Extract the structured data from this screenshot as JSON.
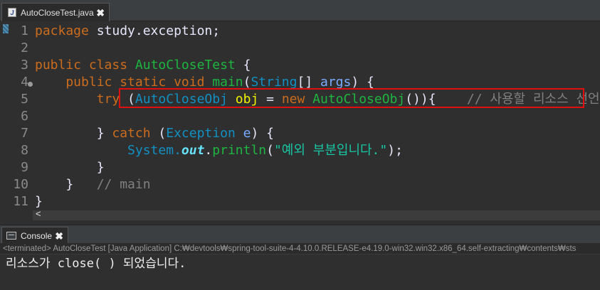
{
  "editor": {
    "tab_label": "AutoCloseTest.java",
    "tab_icon": "java-file-icon",
    "close_glyph": "✖",
    "line_numbers": [
      "1",
      "2",
      "3",
      "4",
      "5",
      "6",
      "7",
      "8",
      "9",
      "10",
      "11"
    ],
    "lines": [
      {
        "segs": [
          {
            "t": "package ",
            "c": "kw"
          },
          {
            "t": "study.exception;",
            "c": "pl"
          }
        ]
      },
      {
        "segs": []
      },
      {
        "segs": [
          {
            "t": "public class ",
            "c": "kw"
          },
          {
            "t": "AutoCloseTest",
            "c": "cls-main"
          },
          {
            "t": " {",
            "c": "pl"
          }
        ]
      },
      {
        "segs": [
          {
            "t": "    public static void ",
            "c": "kw"
          },
          {
            "t": "main",
            "c": "fn"
          },
          {
            "t": "(",
            "c": "pl"
          },
          {
            "t": "String",
            "c": "cls"
          },
          {
            "t": "[] ",
            "c": "pl"
          },
          {
            "t": "args",
            "c": "param"
          },
          {
            "t": ") {",
            "c": "pl"
          }
        ]
      },
      {
        "segs": [
          {
            "t": "        try ",
            "c": "kw"
          },
          {
            "t": "(",
            "c": "pl"
          },
          {
            "t": "AutoCloseObj ",
            "c": "cls"
          },
          {
            "t": "obj",
            "c": "var"
          },
          {
            "t": " = ",
            "c": "pl"
          },
          {
            "t": "new ",
            "c": "kw"
          },
          {
            "t": "AutoCloseObj",
            "c": "fn"
          },
          {
            "t": "()){",
            "c": "pl"
          },
          {
            "t": "    // 사용할 리소스 선언",
            "c": "cmt"
          }
        ]
      },
      {
        "segs": []
      },
      {
        "segs": [
          {
            "t": "        } ",
            "c": "pl"
          },
          {
            "t": "catch ",
            "c": "kw"
          },
          {
            "t": "(",
            "c": "pl"
          },
          {
            "t": "Exception ",
            "c": "cls"
          },
          {
            "t": "e",
            "c": "param"
          },
          {
            "t": ") {",
            "c": "pl"
          }
        ]
      },
      {
        "segs": [
          {
            "t": "            System.",
            "c": "cls"
          },
          {
            "t": "out",
            "c": "fld"
          },
          {
            "t": ".",
            "c": "pl"
          },
          {
            "t": "println",
            "c": "fn"
          },
          {
            "t": "(",
            "c": "pl"
          },
          {
            "t": "\"예외 부분입니다.\"",
            "c": "str"
          },
          {
            "t": ");",
            "c": "pl"
          }
        ]
      },
      {
        "segs": [
          {
            "t": "        }",
            "c": "pl"
          }
        ]
      },
      {
        "segs": [
          {
            "t": "    }   ",
            "c": "pl"
          },
          {
            "t": "// main",
            "c": "cmt"
          }
        ]
      },
      {
        "segs": [
          {
            "t": "}",
            "c": "pl"
          }
        ]
      }
    ],
    "scroll_left_glyph": "<"
  },
  "console": {
    "tab_label": "Console",
    "tab_icon": "console-icon",
    "close_glyph": "✖",
    "status": "<terminated> AutoCloseTest [Java Application] C:₩devtools₩spring-tool-suite-4-4.10.0.RELEASE-e4.19.0-win32.win32.x86_64.self-extracting₩contents₩sts",
    "output": "리소스가 close( ) 되었습니다."
  },
  "colors": {
    "keyword": "#cc6c1d",
    "class": "#1290c3",
    "method": "#1eb540",
    "local_var": "#f2f200",
    "string": "#17c6a3",
    "comment": "#808080",
    "highlight_border": "#e01010"
  }
}
